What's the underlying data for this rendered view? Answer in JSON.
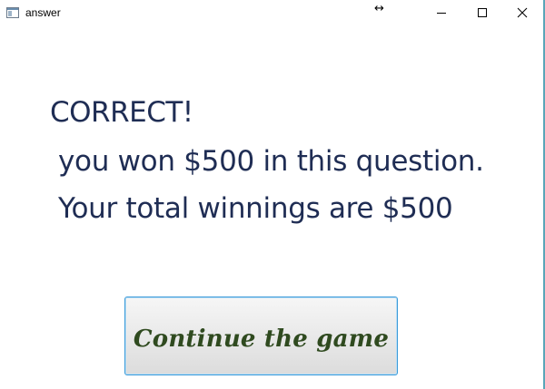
{
  "window": {
    "title": "answer",
    "resize_glyph": "↔",
    "icons": {
      "app": "app-window-icon",
      "minimize": "minimize-icon",
      "maximize": "maximize-icon",
      "close": "close-icon"
    }
  },
  "message": {
    "status": "CORRECT!",
    "won_line": "you won $500 in this question.",
    "total_line": "Your total winnings are $500"
  },
  "actions": {
    "continue_label": "Continue the game"
  },
  "colors": {
    "message_text": "#1f2d54",
    "button_text": "#2f4a1f",
    "button_border": "#3a9ad9"
  }
}
